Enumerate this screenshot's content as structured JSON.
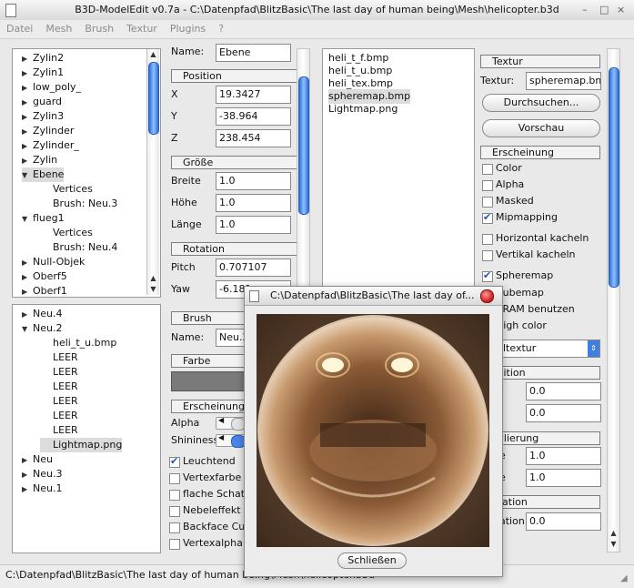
{
  "window": {
    "title": "B3D-ModelEdit v0.7a - C:\\Datenpfad\\BlitzBasic\\The last day of human being\\Mesh\\helicopter.b3d",
    "buttons": [
      "–",
      "□",
      "×"
    ]
  },
  "menu": [
    "Datei",
    "Mesh",
    "Brush",
    "Textur",
    "Plugins",
    "?"
  ],
  "tree_top": [
    {
      "label": "Zylin2",
      "indent": 0,
      "expander": "closed"
    },
    {
      "label": "Zylin1",
      "indent": 0,
      "expander": "closed"
    },
    {
      "label": "low_poly_",
      "indent": 0,
      "expander": "closed"
    },
    {
      "label": "guard",
      "indent": 0,
      "expander": "closed"
    },
    {
      "label": "Zylin3",
      "indent": 0,
      "expander": "closed"
    },
    {
      "label": "Zylinder",
      "indent": 0,
      "expander": "closed"
    },
    {
      "label": "Zylinder_",
      "indent": 0,
      "expander": "closed"
    },
    {
      "label": "Zylin",
      "indent": 0,
      "expander": "closed"
    },
    {
      "label": "Ebene",
      "indent": 0,
      "expander": "open",
      "selected": true
    },
    {
      "label": "Vertices",
      "indent": 1,
      "expander": "none"
    },
    {
      "label": "Brush: Neu.3",
      "indent": 1,
      "expander": "none"
    },
    {
      "label": "flueg1",
      "indent": 0,
      "expander": "open"
    },
    {
      "label": "Vertices",
      "indent": 1,
      "expander": "none"
    },
    {
      "label": "Brush: Neu.4",
      "indent": 1,
      "expander": "none"
    },
    {
      "label": "Null-Objek",
      "indent": 0,
      "expander": "closed"
    },
    {
      "label": "Oberf5",
      "indent": 0,
      "expander": "closed"
    },
    {
      "label": "Oberf1",
      "indent": 0,
      "expander": "closed"
    }
  ],
  "tree_bottom": [
    {
      "label": "Neu.4",
      "indent": 0,
      "expander": "closed"
    },
    {
      "label": "Neu.2",
      "indent": 0,
      "expander": "open"
    },
    {
      "label": "heli_t_u.bmp",
      "indent": 1,
      "expander": "none"
    },
    {
      "label": "LEER",
      "indent": 1,
      "expander": "none"
    },
    {
      "label": "LEER",
      "indent": 1,
      "expander": "none"
    },
    {
      "label": "LEER",
      "indent": 1,
      "expander": "none"
    },
    {
      "label": "LEER",
      "indent": 1,
      "expander": "none"
    },
    {
      "label": "LEER",
      "indent": 1,
      "expander": "none"
    },
    {
      "label": "LEER",
      "indent": 1,
      "expander": "none"
    },
    {
      "label": "Lightmap.png",
      "indent": 1,
      "expander": "none",
      "selected": true
    },
    {
      "label": "Neu",
      "indent": 0,
      "expander": "closed"
    },
    {
      "label": "Neu.3",
      "indent": 0,
      "expander": "closed"
    },
    {
      "label": "Neu.1",
      "indent": 0,
      "expander": "closed"
    }
  ],
  "mesh_props": {
    "name_label": "Name:",
    "name_value": "Ebene",
    "position_title": "Position",
    "x_label": "X",
    "x_value": "19.3427",
    "y_label": "Y",
    "y_value": "-38.964",
    "z_label": "Z",
    "z_value": "238.454",
    "size_title": "Größe",
    "breite_label": "Breite",
    "breite_value": "1.0",
    "hoehe_label": "Höhe",
    "hoehe_value": "1.0",
    "laenge_label": "Länge",
    "laenge_value": "1.0",
    "rotation_title": "Rotation",
    "pitch_label": "Pitch",
    "pitch_value": "0.707107",
    "yaw_label": "Yaw",
    "yaw_value": "-6.181"
  },
  "brush_props": {
    "title": "Brush",
    "name_label": "Name:",
    "name_value": "Neu.2",
    "color_title": "Farbe",
    "appearance_title": "Erscheinung",
    "alpha_label": "Alpha",
    "shininess_label": "Shininess",
    "checkboxes": [
      {
        "label": "Leuchtend",
        "checked": true
      },
      {
        "label": "Vertexfarbe",
        "checked": false
      },
      {
        "label": "flache Schatt",
        "checked": false
      },
      {
        "label": "Nebeleffekt d",
        "checked": false
      },
      {
        "label": "Backface Cu",
        "checked": false
      },
      {
        "label": "Vertexalpha",
        "checked": false
      }
    ]
  },
  "texture_files": [
    "heli_t_f.bmp",
    "heli_t_u.bmp",
    "heli_tex.bmp",
    "spheremap.bmp",
    "Lightmap.png"
  ],
  "texture_props": {
    "title": "Textur",
    "textur_label": "Textur:",
    "textur_value": "spheremap.bmp",
    "browse_button": "Durchsuchen...",
    "preview_button": "Vorschau",
    "appearance_title": "Erscheinung",
    "checkboxes": [
      {
        "label": "Color",
        "checked": false
      },
      {
        "label": "Alpha",
        "checked": false
      },
      {
        "label": "Masked",
        "checked": false
      },
      {
        "label": "Mipmapping",
        "checked": true
      },
      {
        "label": "Horizontal kacheln",
        "checked": false
      },
      {
        "label": "Vertikal kacheln",
        "checked": false
      },
      {
        "label": "Spheremap",
        "checked": true
      },
      {
        "label": "Cubemap",
        "checked": false
      },
      {
        "label": "VRAM benutzen",
        "checked": false
      },
      {
        "label": "High color",
        "checked": false
      }
    ],
    "blend_select": "ltextur",
    "position_title": "osition",
    "pos_u_value": "0.0",
    "pos_v_value": "0.0",
    "scale_title": "kalierung",
    "scale_u_label": "e",
    "scale_u_value": "1.0",
    "scale_v_label": "e",
    "scale_v_value": "1.0",
    "rotation_title": "otation",
    "rotation_label": "ation",
    "rotation_value": "0.0"
  },
  "status": {
    "text": "C:\\Datenpfad\\BlitzBasic\\The last day of human being\\Mesh\\helicopter.b3d"
  },
  "preview_dialog": {
    "title": "C:\\Datenpfad\\BlitzBasic\\The last day of...",
    "close_button": "Schließen"
  },
  "colors": {
    "selection": "#dcdcdc",
    "scroll_thumb": "#3b7ee6",
    "close_red": "#d33"
  }
}
